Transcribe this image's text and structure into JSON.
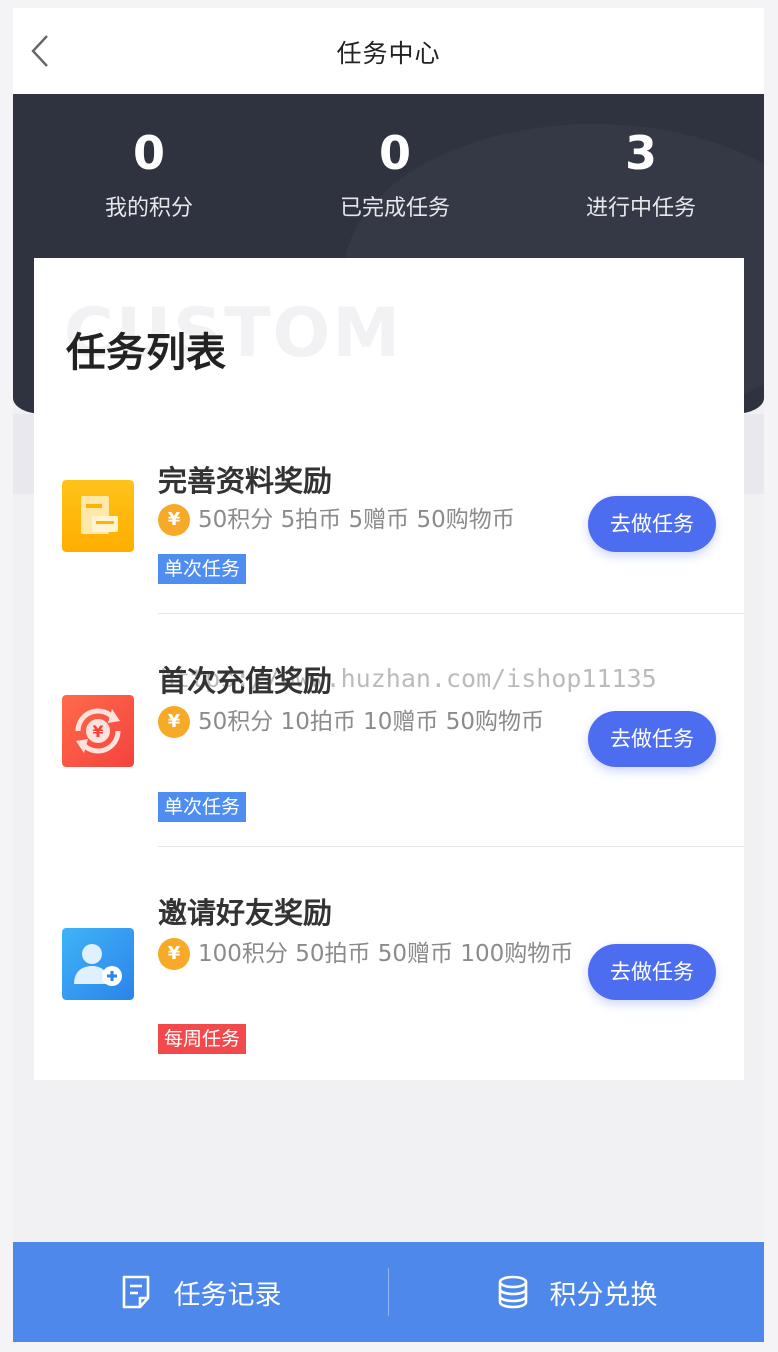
{
  "nav": {
    "title": "任务中心"
  },
  "stats": [
    {
      "value": "0",
      "label": "我的积分"
    },
    {
      "value": "0",
      "label": "已完成任务"
    },
    {
      "value": "3",
      "label": "进行中任务"
    }
  ],
  "card": {
    "ghost": "CUSTOM",
    "heading": "任务列表"
  },
  "tasks": [
    {
      "name": "完善资料奖励",
      "coin": "¥",
      "reward": "50积分  5拍币  5赠币  50购物币",
      "tag": "单次任务",
      "tag_color": "#4f8ef0",
      "button": "去做任务",
      "icon": "profile-doc-icon"
    },
    {
      "name": "首次充值奖励",
      "coin": "¥",
      "reward": "50积分  10拍币  10赠币  50购物币",
      "tag": "单次任务",
      "tag_color": "#4f8ef0",
      "button": "去做任务",
      "icon": "recharge-icon"
    },
    {
      "name": "邀请好友奖励",
      "coin": "¥",
      "reward": "100积分  50拍币  50赠币  100购物币",
      "tag": "每周任务",
      "tag_color": "#f2494c",
      "button": "去做任务",
      "icon": "invite-friend-icon"
    }
  ],
  "watermark": "https://www.huzhan.com/ishop11135",
  "bottom": {
    "records": "任务记录",
    "exchange": "积分兑换"
  },
  "colors": {
    "hero": "#2e333f",
    "button": "#4d6df1",
    "bottom_bar": "#4d88ea",
    "coin": "#f7a928"
  }
}
